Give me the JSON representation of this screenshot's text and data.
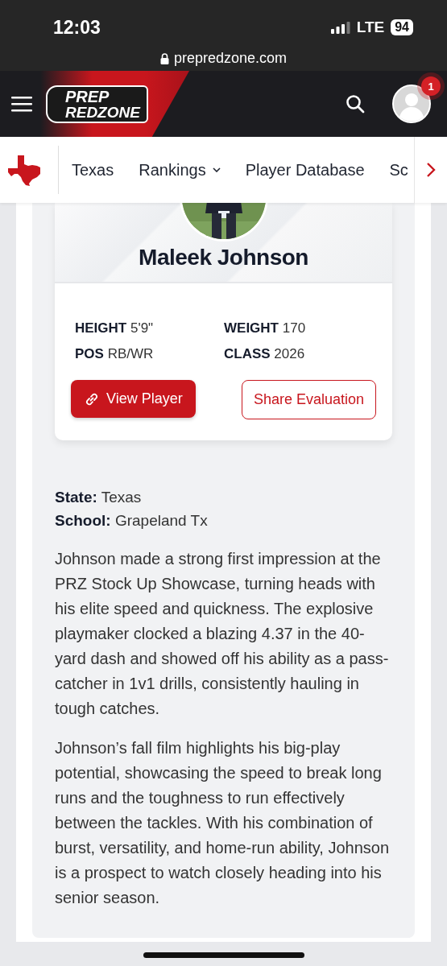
{
  "status_bar": {
    "time": "12:03",
    "network": "LTE",
    "battery": "94"
  },
  "address_bar": {
    "url": "prepredzone.com"
  },
  "header": {
    "logo": [
      "PREP",
      "REDZONE"
    ],
    "notification_count": "1"
  },
  "nav": {
    "items": [
      {
        "label": "Texas",
        "dropdown": false
      },
      {
        "label": "Rankings",
        "dropdown": true
      },
      {
        "label": "Player Database",
        "dropdown": false
      },
      {
        "label": "Sc",
        "dropdown": false
      }
    ]
  },
  "player": {
    "name": "Maleek Johnson",
    "stats": [
      {
        "label": "HEIGHT",
        "value": "5'9\""
      },
      {
        "label": "WEIGHT",
        "value": "170"
      },
      {
        "label": "POS",
        "value": "RB/WR"
      },
      {
        "label": "CLASS",
        "value": "2026"
      }
    ],
    "buttons": [
      {
        "label": "View Player",
        "kind": "primary"
      },
      {
        "label": "Share Evaluation",
        "kind": "outline"
      }
    ]
  },
  "details": [
    {
      "label": "State:",
      "value": "Texas"
    },
    {
      "label": "School:",
      "value": "Grapeland Tx"
    }
  ],
  "paragraphs": [
    "Johnson made a strong first impression at the PRZ Stock Up Showcase, turning heads with his elite speed and quickness. The explosive playmaker clocked a blazing 4.37 in the 40-yard dash and showed off his ability as a pass-catcher in 1v1 drills, consistently hauling in tough catches.",
    "Johnson’s fall film highlights his big-play potential, showcasing the speed to break long runs and the toughness to run effectively between the tackles. With his combination of burst, versatility, and home-run ability, Johnson is a prospect to watch closely heading into his senior season."
  ]
}
